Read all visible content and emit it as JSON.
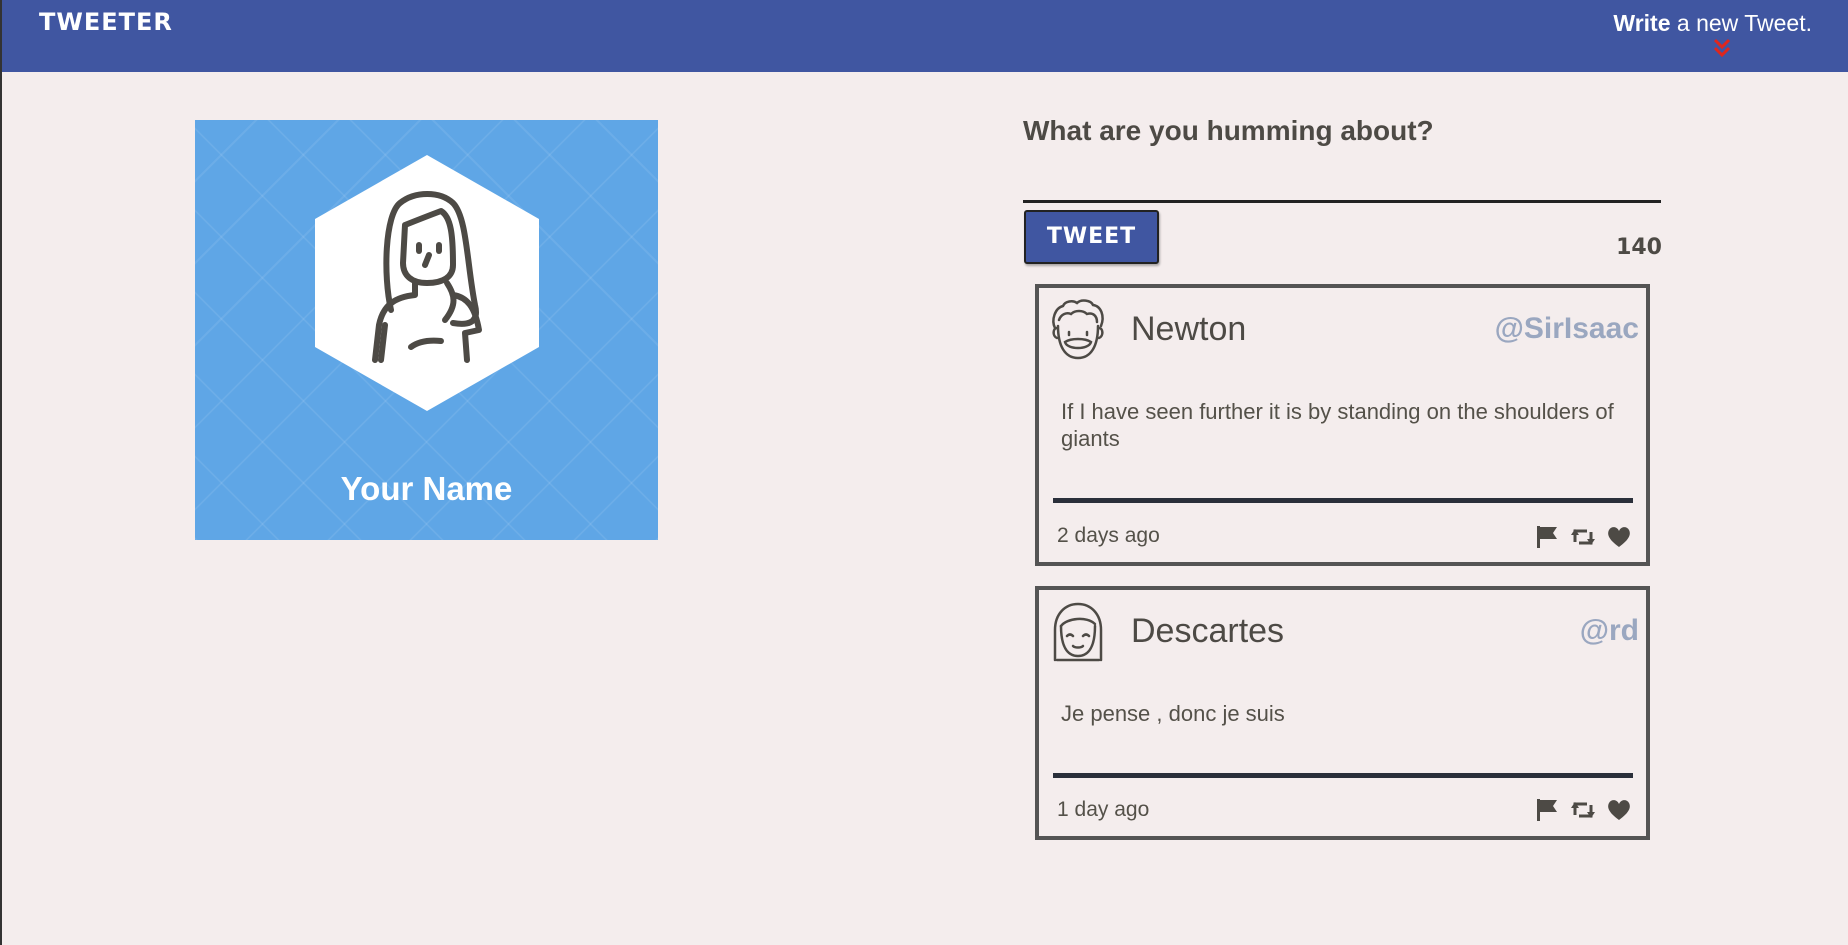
{
  "nav": {
    "brand": "TWEETER",
    "compose_bold": "Write",
    "compose_rest": " a new Tweet.",
    "accent": "#4056a1",
    "chevron_color": "#e0261c"
  },
  "profile": {
    "name": "Your Name",
    "card_color": "#5fa6e6"
  },
  "composer": {
    "prompt": "What are you humming about?",
    "button_label": "TWEET",
    "counter": "140"
  },
  "tweets": [
    {
      "name": "Newton",
      "handle": "@SirIsaac",
      "text": "If I have seen further it is by standing on the shoulders of giants",
      "time": "2 days ago",
      "avatar_icon": "curly-hair-man-avatar-icon"
    },
    {
      "name": "Descartes",
      "handle": "@rd",
      "text": "Je pense , donc je suis",
      "time": "1 day ago",
      "avatar_icon": "bob-hair-avatar-icon"
    }
  ],
  "icons": [
    "flag-icon",
    "retweet-icon",
    "heart-icon",
    "chevron-down-icon",
    "user-avatar-icon"
  ]
}
